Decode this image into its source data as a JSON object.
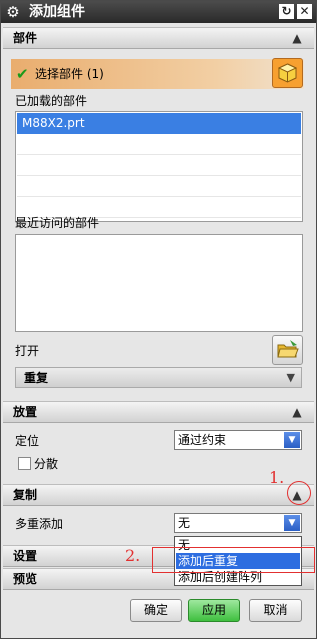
{
  "window": {
    "title": "添加组件"
  },
  "sections": {
    "parts": {
      "header": "部件",
      "select_label": "选择部件 (1)",
      "loaded_label": "已加载的部件",
      "loaded_items": [
        "M88X2.prt"
      ],
      "recent_label": "最近访问的部件",
      "open_label": "打开",
      "repeat_label": "重复"
    },
    "placement": {
      "header": "放置",
      "position_label": "定位",
      "position_value": "通过约束",
      "scatter_label": "分散"
    },
    "copy": {
      "header": "复制",
      "multi_add_label": "多重添加",
      "multi_add_value": "无",
      "options": [
        "无",
        "添加后重复",
        "添加后创建阵列"
      ],
      "highlighted_index": 1
    },
    "settings": {
      "header": "设置"
    },
    "preview": {
      "header": "预览"
    }
  },
  "annotations": {
    "step1": "1.",
    "step2": "2."
  },
  "buttons": {
    "ok": "确定",
    "apply": "应用",
    "cancel": "取消"
  },
  "colors": {
    "accent": "#3a7fe3",
    "annotation": "#e23030",
    "apply": "#3fbf3f",
    "select_row": "#e9ad6e"
  },
  "icons": [
    "gear-icon",
    "reset-icon",
    "close-icon",
    "collapse-icon",
    "check-icon",
    "cube-icon",
    "folder-icon",
    "chevron-down-icon"
  ]
}
